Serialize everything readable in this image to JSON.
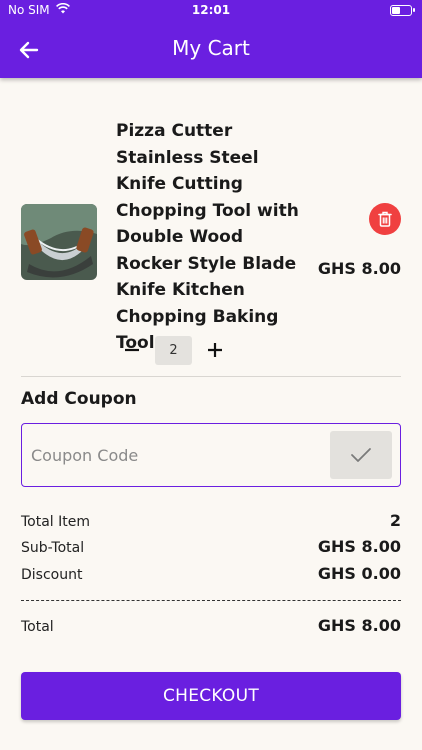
{
  "status_bar": {
    "carrier": "No SIM",
    "time": "12:01"
  },
  "header": {
    "title": "My Cart",
    "back_icon": "arrow-left-icon"
  },
  "cart": {
    "items": [
      {
        "name": "Pizza Cutter Stainless Steel Knife Cutting Chopping Tool with Double Wood Rocker Style Blade Knife Kitchen Chopping Baking Tools",
        "price": "GHS 8.00",
        "quantity": "2",
        "image_icon": "rocker-knife-image"
      }
    ]
  },
  "coupon": {
    "title": "Add Coupon",
    "placeholder": "Coupon Code",
    "value": ""
  },
  "summary": {
    "total_item_label": "Total Item",
    "total_item_value": "2",
    "subtotal_label": "Sub-Total",
    "subtotal_value": "GHS 8.00",
    "discount_label": "Discount",
    "discount_value": "GHS 0.00",
    "total_label": "Total",
    "total_value": "GHS 8.00"
  },
  "checkout": {
    "label": "CHECKOUT"
  },
  "colors": {
    "primary": "#6a1fe0",
    "danger": "#f04040",
    "background": "#fbf8f3"
  }
}
